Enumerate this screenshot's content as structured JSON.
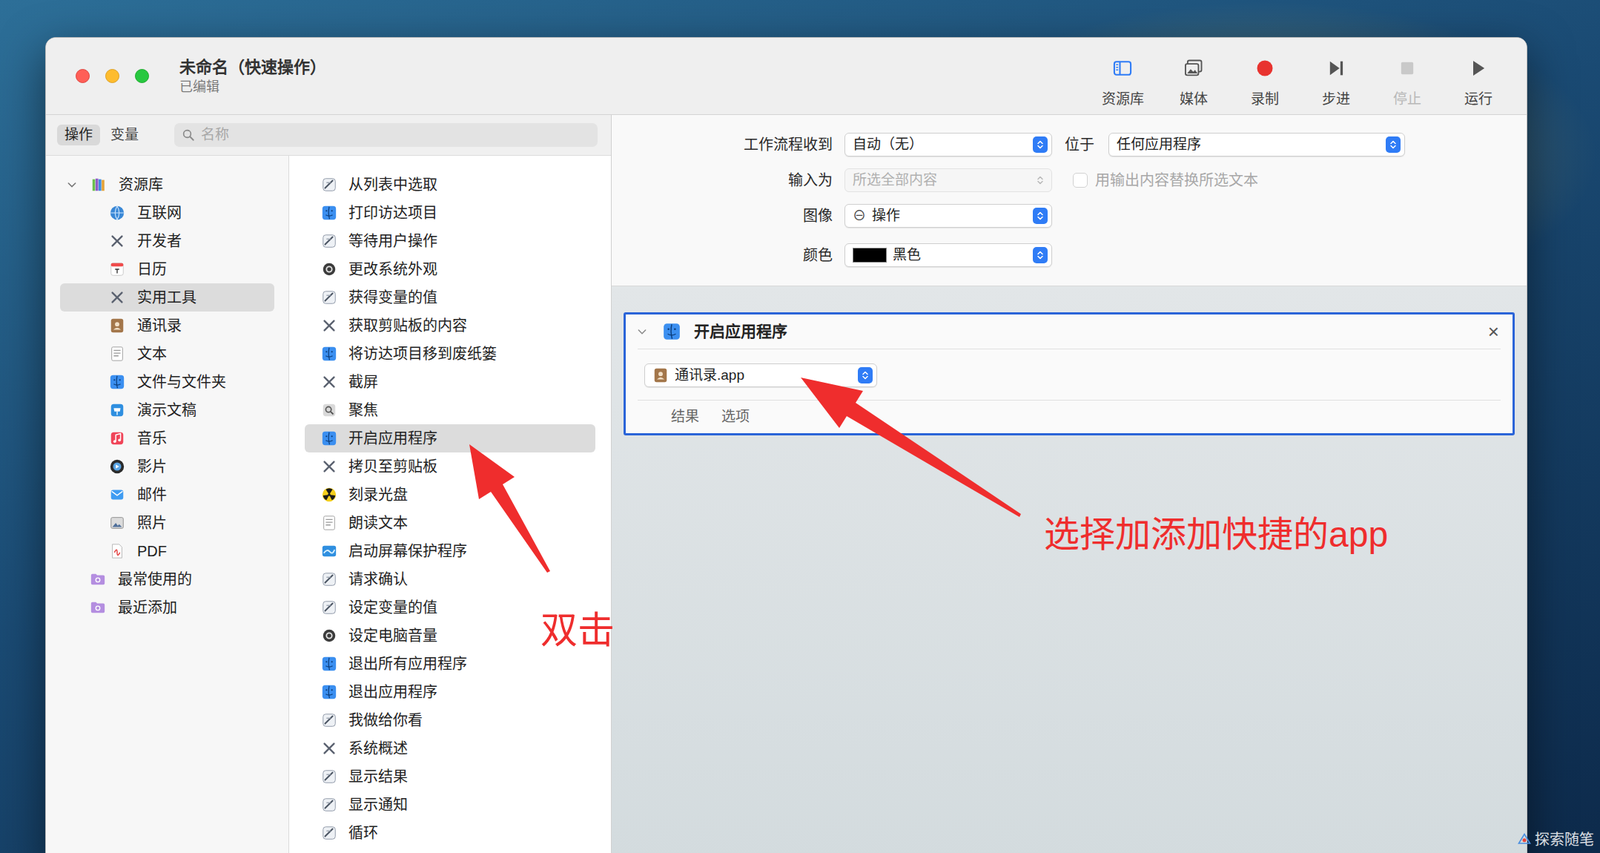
{
  "window": {
    "title": "未命名（快速操作）",
    "subtitle": "已编辑"
  },
  "toolbar": [
    {
      "label": "资源库",
      "disabled": false
    },
    {
      "label": "媒体",
      "disabled": false
    },
    {
      "label": "录制",
      "disabled": false
    },
    {
      "label": "步进",
      "disabled": false
    },
    {
      "label": "停止",
      "disabled": true
    },
    {
      "label": "运行",
      "disabled": false
    }
  ],
  "library_tabs": [
    {
      "label": "操作",
      "selected": true
    },
    {
      "label": "变量",
      "selected": false
    }
  ],
  "search": {
    "placeholder": "名称"
  },
  "library": [
    {
      "label": "资源库",
      "kind": "root",
      "expanded": true,
      "selected": false
    },
    {
      "label": "互联网",
      "kind": "category",
      "selected": false
    },
    {
      "label": "开发者",
      "kind": "category",
      "selected": false
    },
    {
      "label": "日历",
      "kind": "category",
      "selected": false
    },
    {
      "label": "实用工具",
      "kind": "category",
      "selected": true
    },
    {
      "label": "通讯录",
      "kind": "category",
      "selected": false
    },
    {
      "label": "文本",
      "kind": "category",
      "selected": false
    },
    {
      "label": "文件与文件夹",
      "kind": "category",
      "selected": false
    },
    {
      "label": "演示文稿",
      "kind": "category",
      "selected": false
    },
    {
      "label": "音乐",
      "kind": "category",
      "selected": false
    },
    {
      "label": "影片",
      "kind": "category",
      "selected": false
    },
    {
      "label": "邮件",
      "kind": "category",
      "selected": false
    },
    {
      "label": "照片",
      "kind": "category",
      "selected": false
    },
    {
      "label": "PDF",
      "kind": "category",
      "selected": false
    },
    {
      "label": "最常使用的",
      "kind": "folder",
      "selected": false
    },
    {
      "label": "最近添加",
      "kind": "folder",
      "selected": false
    }
  ],
  "actions": [
    {
      "label": "从列表中选取",
      "selected": false
    },
    {
      "label": "打印访达项目",
      "selected": false
    },
    {
      "label": "等待用户操作",
      "selected": false
    },
    {
      "label": "更改系统外观",
      "selected": false
    },
    {
      "label": "获得变量的值",
      "selected": false
    },
    {
      "label": "获取剪贴板的内容",
      "selected": false
    },
    {
      "label": "将访达项目移到废纸篓",
      "selected": false
    },
    {
      "label": "截屏",
      "selected": false
    },
    {
      "label": "聚焦",
      "selected": false
    },
    {
      "label": "开启应用程序",
      "selected": true
    },
    {
      "label": "拷贝至剪贴板",
      "selected": false
    },
    {
      "label": "刻录光盘",
      "selected": false
    },
    {
      "label": "朗读文本",
      "selected": false
    },
    {
      "label": "启动屏幕保护程序",
      "selected": false
    },
    {
      "label": "请求确认",
      "selected": false
    },
    {
      "label": "设定变量的值",
      "selected": false
    },
    {
      "label": "设定电脑音量",
      "selected": false
    },
    {
      "label": "退出所有应用程序",
      "selected": false
    },
    {
      "label": "退出应用程序",
      "selected": false
    },
    {
      "label": "我做给你看",
      "selected": false
    },
    {
      "label": "系统概述",
      "selected": false
    },
    {
      "label": "显示结果",
      "selected": false
    },
    {
      "label": "显示通知",
      "selected": false
    },
    {
      "label": "循环",
      "selected": false
    }
  ],
  "workflow": {
    "rows": [
      {
        "label": "工作流程收到",
        "value": "自动（无）",
        "disabled": false
      },
      {
        "label": "输入为",
        "value": "所选全部内容",
        "disabled": true
      },
      {
        "label": "图像",
        "icon": "⊖",
        "value": "操作",
        "disabled": false
      },
      {
        "label": "颜色",
        "value": "黑色",
        "color": "#000000",
        "disabled": false
      }
    ],
    "location": {
      "label": "位于",
      "value": "任何应用程序"
    },
    "replace_checkbox": {
      "label": "用输出内容替换所选文本",
      "checked": false,
      "disabled": true
    }
  },
  "action_card": {
    "title": "开启应用程序",
    "selected": true,
    "expanded": true,
    "close": "×",
    "app": "通讯录.app",
    "tabs": [
      "结果",
      "选项"
    ]
  },
  "annotations": [
    {
      "text": "双击"
    },
    {
      "text": "选择加添加快捷的app"
    }
  ],
  "watermark": "探索随笔"
}
